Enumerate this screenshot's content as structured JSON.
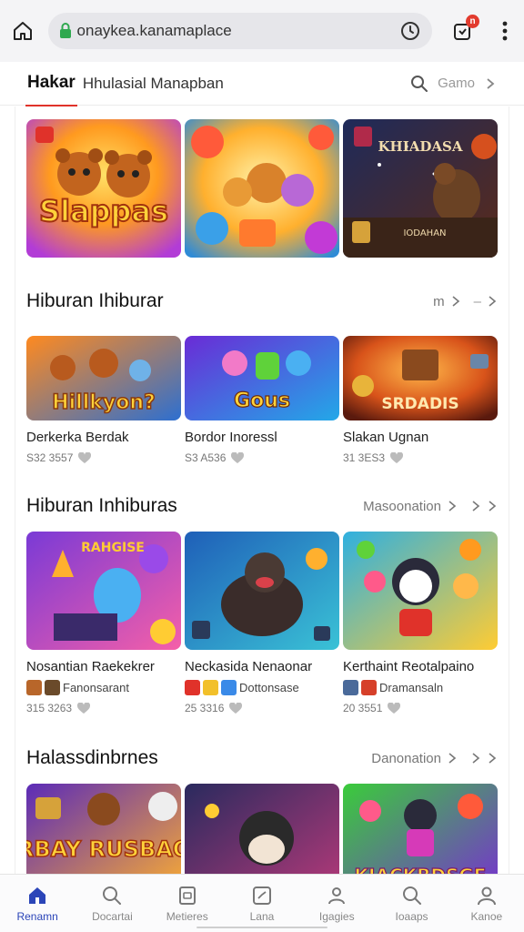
{
  "browser": {
    "url": "onaykea.kanamaplace",
    "tab_count": "n"
  },
  "header": {
    "brand": "Hakar",
    "title": "Hhulasial Manapban",
    "search_label": "Gamo"
  },
  "featured": [
    {
      "label": "Slappas",
      "palette": [
        "#ff9a1f",
        "#b23cd6"
      ]
    },
    {
      "label": "",
      "palette": [
        "#ffb02e",
        "#2f8bd6"
      ]
    },
    {
      "label": "KHIADASA",
      "secondary": "IODAHAN",
      "palette": [
        "#1e2a5a",
        "#5a2a1a"
      ]
    }
  ],
  "sections": [
    {
      "title": "Hiburan Ihiburar",
      "action": "m",
      "cards": [
        {
          "art": "Hillkyon?",
          "title": "Derkerka Berdak",
          "meta": "S32 3557",
          "palette": [
            "#ff8a1f",
            "#2d6fd0"
          ]
        },
        {
          "art": "Gous",
          "title": "Bordor Inoressl",
          "meta": "S3 A536",
          "palette": [
            "#6a2bd6",
            "#23a8e8"
          ]
        },
        {
          "art": "SRDADIS",
          "title": "Slakan Ugnan",
          "meta": "31 3ES3",
          "palette": [
            "#d8531a",
            "#5a1a0e"
          ]
        }
      ]
    },
    {
      "title": "Hiburan Inhiburas",
      "action": "Masoonation",
      "cards": [
        {
          "art": "RAHGISE",
          "title": "Nosantian Raekekrer",
          "sub": "Fanonsarant",
          "meta": "315 3263",
          "palette": [
            "#7a3ad6",
            "#f55fa8"
          ]
        },
        {
          "art": "",
          "title": "Neckasida Nenaonar",
          "sub": "Dottonsase",
          "meta": "25 3316",
          "palette": [
            "#1f5fb8",
            "#3ac2d6"
          ]
        },
        {
          "art": "",
          "title": "Kerthaint Reotalpaino",
          "sub": "Dramansaln",
          "meta": "20 3551",
          "palette": [
            "#2fb0e0",
            "#ffcc33"
          ]
        }
      ]
    },
    {
      "title": "Halassdinbrnes",
      "action": "Danonation",
      "cards": [
        {
          "art": "BRBAY RUSBAOS",
          "palette": [
            "#5b2bb8",
            "#ffb02e"
          ]
        },
        {
          "art": "",
          "palette": [
            "#2a2a5e",
            "#b83a7a"
          ]
        },
        {
          "art": "KIACKBDSGE",
          "palette": [
            "#3acc3a",
            "#7a2bd6"
          ]
        }
      ]
    }
  ],
  "bottom_nav": [
    {
      "label": "Renamn",
      "icon": "home-icon",
      "active": true
    },
    {
      "label": "Docartai",
      "icon": "search-icon"
    },
    {
      "label": "Metieres",
      "icon": "note-icon"
    },
    {
      "label": "Lana",
      "icon": "chart-icon"
    },
    {
      "label": "Igagies",
      "icon": "people-icon"
    },
    {
      "label": "Ioaaps",
      "icon": "search-icon"
    },
    {
      "label": "Kanoe",
      "icon": "profile-icon"
    }
  ],
  "colors": {
    "accent_red": "#e0322a",
    "nav_active": "#2b45b8",
    "lock_green": "#2fa84f"
  }
}
